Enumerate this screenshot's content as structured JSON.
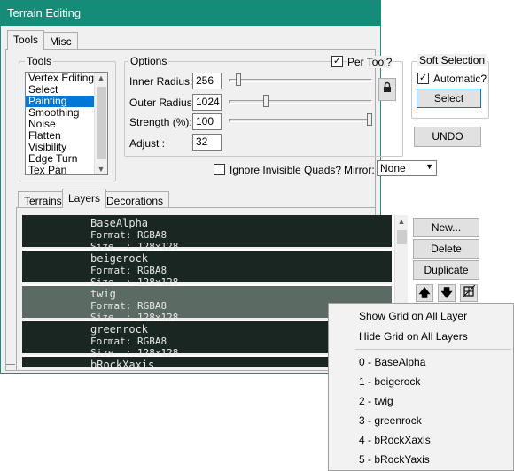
{
  "window": {
    "title": "Terrain Editing"
  },
  "main_tabs": [
    {
      "label": "Tools"
    },
    {
      "label": "Misc"
    }
  ],
  "tools": {
    "group_label": "Tools",
    "items": [
      "Vertex Editing",
      "Select",
      "Painting",
      "Smoothing",
      "Noise",
      "Flatten",
      "Visibility",
      "Edge Turn",
      "Tex Pan"
    ],
    "selected": "Painting"
  },
  "options": {
    "group_label": "Options",
    "per_tool_label": "Per Tool?",
    "per_tool_checked": true,
    "inner_radius": {
      "label": "Inner Radius:",
      "value": "256",
      "slider": 0.05
    },
    "outer_radius": {
      "label": "Outer Radius:",
      "value": "1024",
      "slider": 0.25
    },
    "strength": {
      "label": "Strength (%):",
      "value": "100",
      "slider": 1.0
    },
    "adjust": {
      "label": "Adjust :",
      "value": "32"
    },
    "lock_icon": "lock-icon"
  },
  "soft_selection": {
    "group_label": "Soft Selection",
    "automatic_label": "Automatic?",
    "automatic_checked": true,
    "select_button": "Select"
  },
  "undo_button": "UNDO",
  "ignore_invisible": {
    "label": "Ignore Invisible Quads?",
    "checked": false
  },
  "mirror": {
    "label": "Mirror:",
    "value": "None"
  },
  "sub_tabs": [
    {
      "label": "Terrains"
    },
    {
      "label": "Layers"
    },
    {
      "label": "Decorations"
    }
  ],
  "layers": [
    {
      "name": "BaseAlpha",
      "format": "Format: RGBA8",
      "size": "Size  : 128x128"
    },
    {
      "name": "beigerock",
      "format": "Format: RGBA8",
      "size": "Size  : 128x128"
    },
    {
      "name": "twig",
      "format": "Format: RGBA8",
      "size": "Size  : 128x128"
    },
    {
      "name": "greenrock",
      "format": "Format: RGBA8",
      "size": "Size  : 128x128"
    },
    {
      "name": "bRockXaxis",
      "format": "",
      "size": ""
    }
  ],
  "layer_buttons": {
    "new": "New...",
    "delete": "Delete",
    "duplicate": "Duplicate"
  },
  "layer_icons": {
    "up": "arrow-up-icon",
    "down": "arrow-down-icon",
    "grid": "grid-icon"
  },
  "context_menu": {
    "items": [
      "Show Grid on All Layer",
      "Hide Grid on All Layers"
    ],
    "layer_items": [
      "0 - BaseAlpha",
      "1 - beigerock",
      "2 - twig",
      "3 - greenrock",
      "4 - bRockXaxis",
      "5 - bRockYaxis"
    ]
  },
  "colors": {
    "titlebar": "#148c78",
    "selection": "#0078d7",
    "layer_bg": "#1a2622",
    "layer_selected_bg": "#5b6b63"
  }
}
